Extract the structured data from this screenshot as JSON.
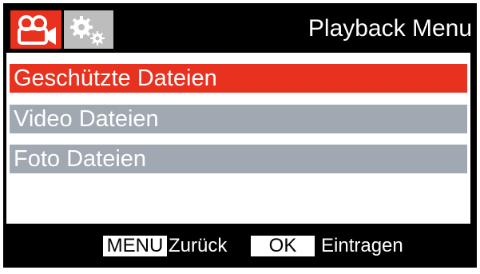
{
  "header": {
    "title": "Playback Menu",
    "tabs": [
      {
        "name": "video",
        "icon": "video-camera-icon",
        "active": true
      },
      {
        "name": "settings",
        "icon": "gears-icon",
        "active": false
      }
    ]
  },
  "menu": {
    "items": [
      {
        "label": "Geschützte Dateien",
        "selected": true
      },
      {
        "label": "Video Dateien",
        "selected": false
      },
      {
        "label": "Foto Dateien",
        "selected": false
      }
    ]
  },
  "footer": {
    "menu_key": "MENU",
    "menu_action": "Zurück",
    "ok_key": "OK",
    "ok_action": "Eintragen"
  },
  "colors": {
    "accent_red": "#e8321f",
    "item_gray": "#a0a9b1",
    "inactive_tab": "#bdbdbd",
    "background": "#000000"
  }
}
